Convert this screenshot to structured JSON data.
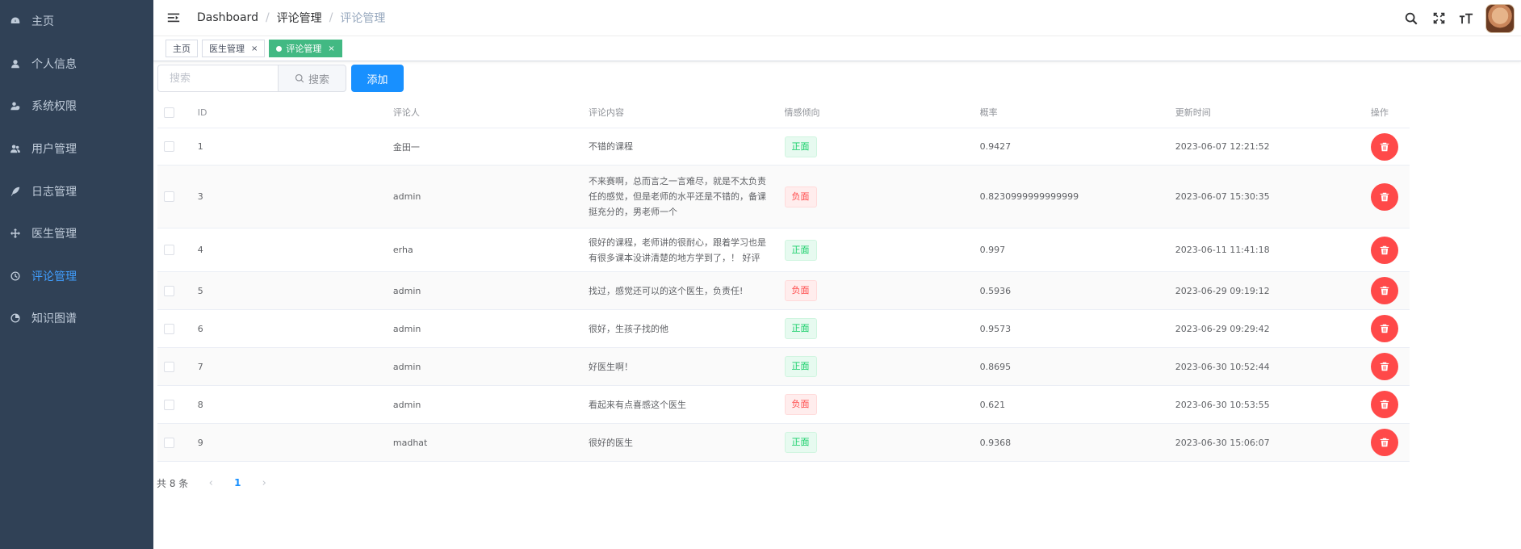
{
  "sidebar": {
    "items": [
      {
        "label": "主页",
        "icon": "dashboard-icon"
      },
      {
        "label": "个人信息",
        "icon": "user-icon"
      },
      {
        "label": "系统权限",
        "icon": "user-shield-icon"
      },
      {
        "label": "用户管理",
        "icon": "users-icon"
      },
      {
        "label": "日志管理",
        "icon": "feather-icon"
      },
      {
        "label": "医生管理",
        "icon": "move-icon"
      },
      {
        "label": "评论管理",
        "icon": "clock-icon",
        "active": true
      },
      {
        "label": "知识图谱",
        "icon": "chart-icon"
      }
    ]
  },
  "navbar": {
    "breadcrumb": [
      "Dashboard",
      "评论管理",
      "评论管理"
    ],
    "separator": "/"
  },
  "tags": [
    {
      "label": "主页"
    },
    {
      "label": "医生管理",
      "close": "×"
    },
    {
      "label": "评论管理",
      "close": "×",
      "active": true
    }
  ],
  "toolbar": {
    "search_placeholder": "搜索",
    "search_button": "搜索",
    "add_button": "添加"
  },
  "table": {
    "headers": {
      "id": "ID",
      "user": "评论人",
      "content": "评论内容",
      "sentiment": "情感倾向",
      "probability": "概率",
      "time": "更新时间",
      "op": "操作"
    },
    "rows": [
      {
        "id": "1",
        "user": "金田一",
        "content": "不错的课程",
        "sentiment": "正面",
        "type": "pos",
        "probability": "0.9427",
        "time": "2023-06-07 12:21:52"
      },
      {
        "id": "3",
        "user": "admin",
        "content": "不来赛啊，总而言之一言难尽，就是不太负责任的感觉，但是老师的水平还是不错的，备课挺充分的，男老师一个",
        "sentiment": "负面",
        "type": "neg",
        "probability": "0.8230999999999999",
        "time": "2023-06-07 15:30:35"
      },
      {
        "id": "4",
        "user": "erha",
        "content": "很好的课程，老师讲的很耐心，跟着学习也是有很多课本没讲清楚的地方学到了，！ 好评",
        "sentiment": "正面",
        "type": "pos",
        "probability": "0.997",
        "time": "2023-06-11 11:41:18"
      },
      {
        "id": "5",
        "user": "admin",
        "content": "找过，感觉还可以的这个医生，负责任!",
        "sentiment": "负面",
        "type": "neg",
        "probability": "0.5936",
        "time": "2023-06-29 09:19:12"
      },
      {
        "id": "6",
        "user": "admin",
        "content": "很好，生孩子找的他",
        "sentiment": "正面",
        "type": "pos",
        "probability": "0.9573",
        "time": "2023-06-29 09:29:42"
      },
      {
        "id": "7",
        "user": "admin",
        "content": "好医生啊！",
        "sentiment": "正面",
        "type": "pos",
        "probability": "0.8695",
        "time": "2023-06-30 10:52:44"
      },
      {
        "id": "8",
        "user": "admin",
        "content": "看起来有点喜感这个医生",
        "sentiment": "负面",
        "type": "neg",
        "probability": "0.621",
        "time": "2023-06-30 10:53:55"
      },
      {
        "id": "9",
        "user": "madhat",
        "content": "很好的医生",
        "sentiment": "正面",
        "type": "pos",
        "probability": "0.9368",
        "time": "2023-06-30 15:06:07"
      }
    ]
  },
  "pagination": {
    "total": "共 8 条",
    "current_page": "1",
    "prev": "‹",
    "next": "›"
  },
  "colors": {
    "sidebar_bg": "#304156",
    "active_menu": "#409eff",
    "primary": "#1890ff",
    "positive": "#13ce66",
    "negative": "#ff4949",
    "tag_active": "#42b983"
  }
}
